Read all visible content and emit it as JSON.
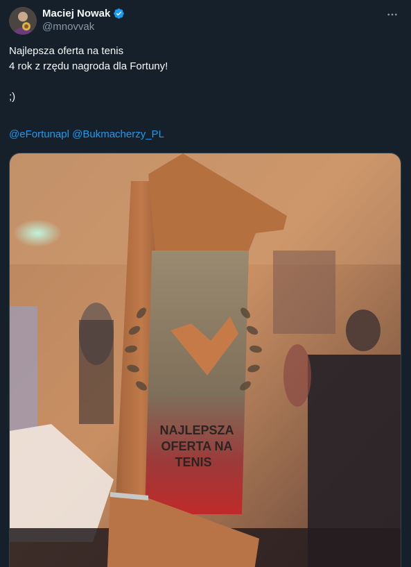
{
  "author": {
    "display_name": "Maciej Nowak",
    "handle": "@mnovvak",
    "verified": true,
    "avatar_icon": "avatar-photo"
  },
  "more_menu_icon": "more-horizontal-icon",
  "tweet": {
    "lines": [
      "Najlepsza oferta na tenis",
      "4 rok z rzędu nagroda dla Fortuny!",
      "",
      ";)"
    ],
    "mentions": [
      "@eFortunapl",
      "@Bukmacherzy_PL"
    ]
  },
  "media": {
    "trophy_text_line1": "NAJLEPSZA",
    "trophy_text_line2": "OFERTA NA",
    "trophy_text_line3": "TENIS"
  },
  "colors": {
    "background": "#15202b",
    "link": "#1d9bf0",
    "secondary_text": "#8b98a5",
    "verified_badge": "#1d9bf0"
  }
}
